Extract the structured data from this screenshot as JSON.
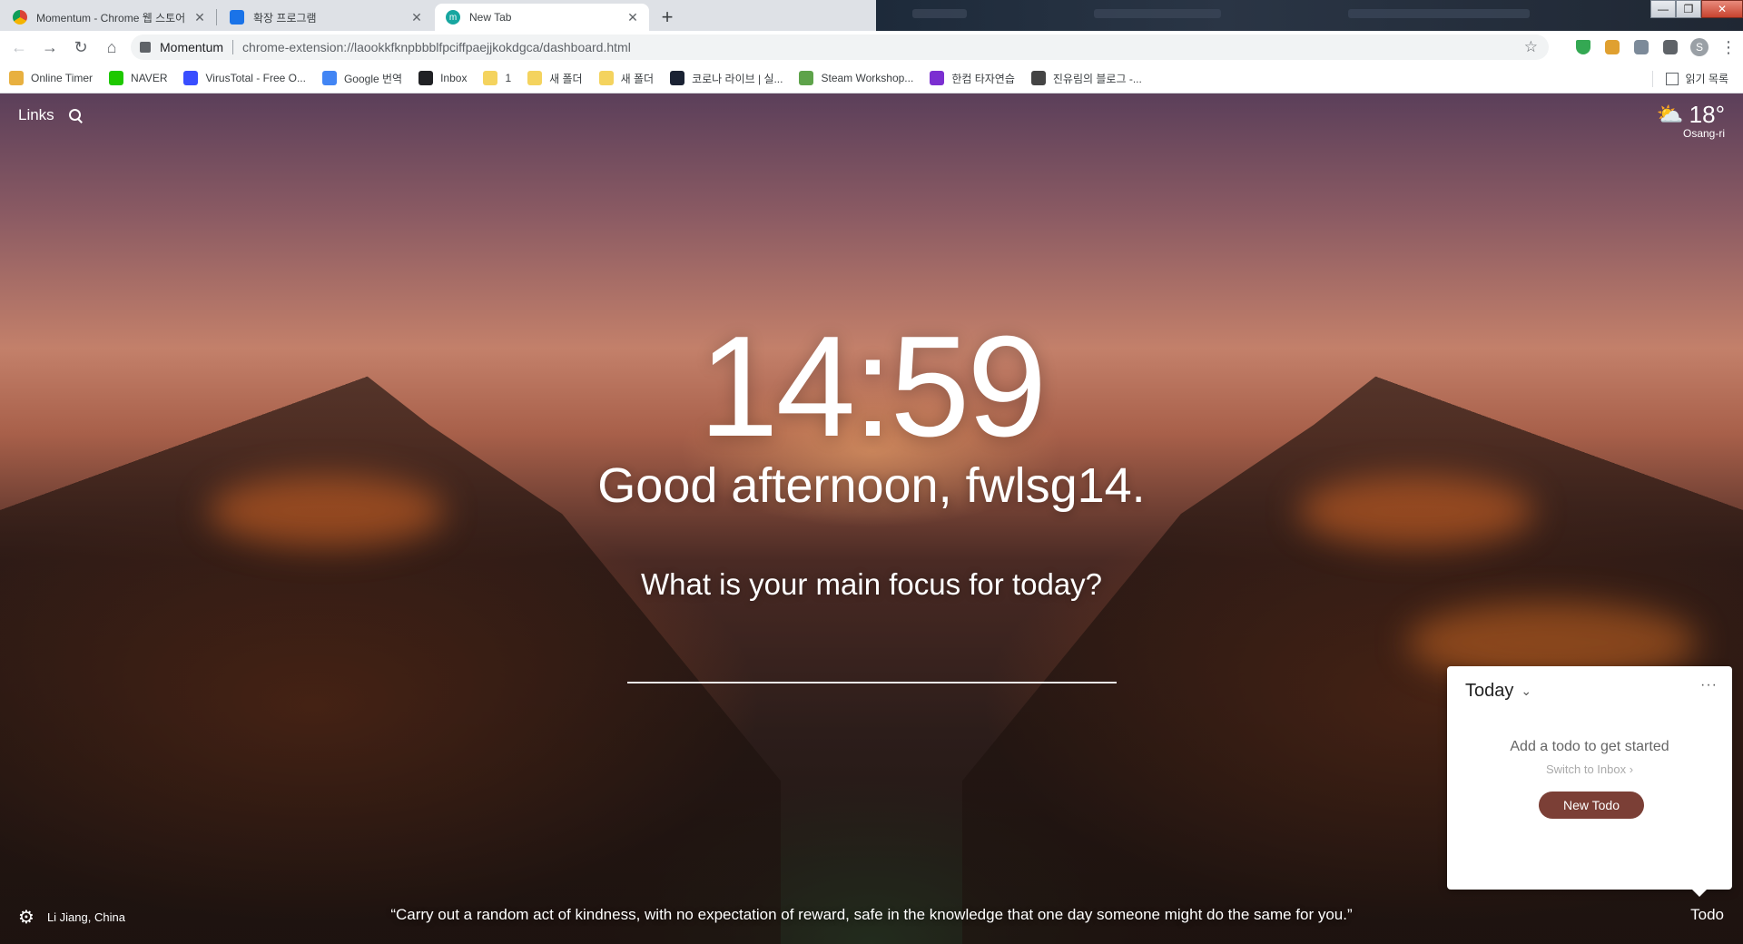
{
  "tabs": [
    {
      "title": "Momentum - Chrome 웹 스토어",
      "active": false,
      "favicon": "chrome-webstore-icon"
    },
    {
      "title": "확장 프로그램",
      "active": false,
      "favicon": "puzzle-icon"
    },
    {
      "title": "New Tab",
      "active": true,
      "favicon": "momentum-icon"
    }
  ],
  "toolbar": {
    "site_name": "Momentum",
    "url": "chrome-extension://laookkfknpbbblfpciffpaejjkokdgca/dashboard.html",
    "profile_initial": "S"
  },
  "bookmarks": [
    {
      "label": "Online Timer",
      "icon": "timer-icon",
      "color": "#e8b040"
    },
    {
      "label": "NAVER",
      "icon": "naver-icon",
      "color": "#1ec800"
    },
    {
      "label": "VirusTotal - Free O...",
      "icon": "virustotal-icon",
      "color": "#394eff"
    },
    {
      "label": "Google 번역",
      "icon": "translate-icon",
      "color": "#4285f4"
    },
    {
      "label": "Inbox",
      "icon": "inbox-icon",
      "color": "#202124"
    },
    {
      "label": "1",
      "icon": "folder-icon",
      "color": "#f4d35e"
    },
    {
      "label": "새 폴더",
      "icon": "folder-icon",
      "color": "#f4d35e"
    },
    {
      "label": "새 폴더",
      "icon": "folder-icon",
      "color": "#f4d35e"
    },
    {
      "label": "코로나 라이브 | 실...",
      "icon": "corona-live-icon",
      "color": "#1a2233"
    },
    {
      "label": "Steam Workshop...",
      "icon": "steam-workshop-icon",
      "color": "#5ea34a"
    },
    {
      "label": "한컴 타자연습",
      "icon": "hancom-icon",
      "color": "#7b2fd1"
    },
    {
      "label": "진유림의 블로그 -...",
      "icon": "blog-icon",
      "color": "#444444"
    }
  ],
  "reading_list": "읽기 목록",
  "momentum": {
    "links_label": "Links",
    "weather": {
      "temp": "18°",
      "location": "Osang-ri"
    },
    "time": "14:59",
    "greeting": "Good afternoon, fwlsg14.",
    "focus_question": "What is your main focus for today?",
    "photo_location": "Li Jiang, China",
    "quote": "“Carry out a random act of kindness, with no expectation of reward, safe in the knowledge that one day someone might do the same for you.”",
    "todo_link": "Todo",
    "todo_panel": {
      "list_name": "Today",
      "empty_text": "Add a todo to get started",
      "switch_text": "Switch to Inbox",
      "new_button": "New Todo"
    }
  },
  "colors": {
    "accent_todo_button": "#7b3f36"
  }
}
